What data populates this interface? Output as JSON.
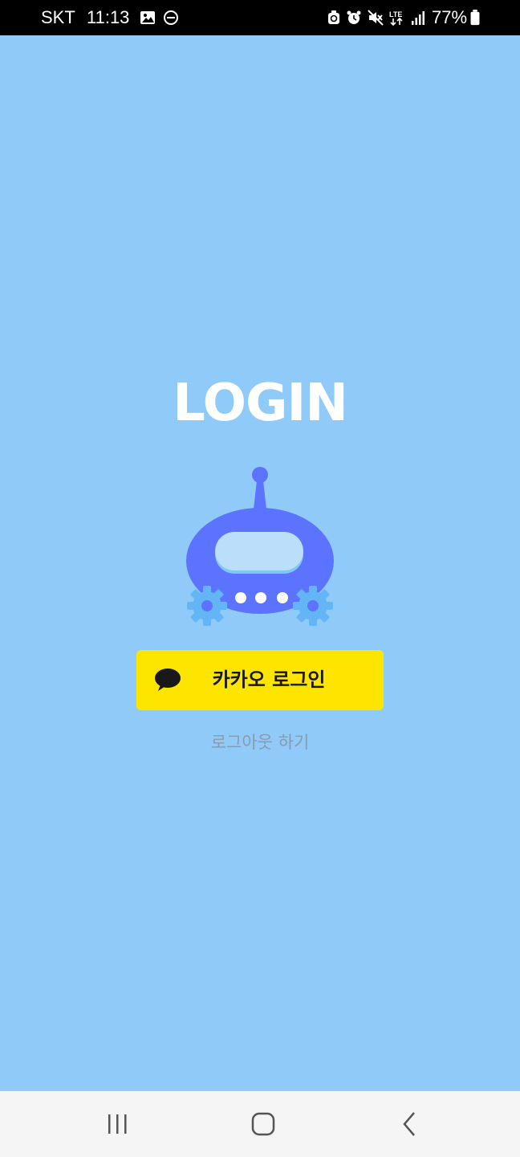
{
  "status_bar": {
    "carrier": "SKT",
    "time": "11:13",
    "battery": "77%",
    "icons": [
      "gallery-icon",
      "dnd-icon",
      "sync-icon",
      "alarm-icon",
      "mute-icon",
      "lte-icon",
      "signal-icon",
      "battery-icon"
    ]
  },
  "login": {
    "title": "LOGIN",
    "logo": "robot-icon",
    "kakao_button_label": "카카오 로그인",
    "kakao_icon": "speech-bubble-icon",
    "logout_label": "로그아웃 하기"
  },
  "nav": {
    "buttons": [
      "recent-apps-icon",
      "home-icon",
      "back-icon"
    ]
  },
  "colors": {
    "background": "#90CAF9",
    "kakao_yellow": "#FEE500",
    "robot_body": "#5B73FF",
    "gear": "#64B5F6",
    "logout_text": "#8A9AAE"
  }
}
